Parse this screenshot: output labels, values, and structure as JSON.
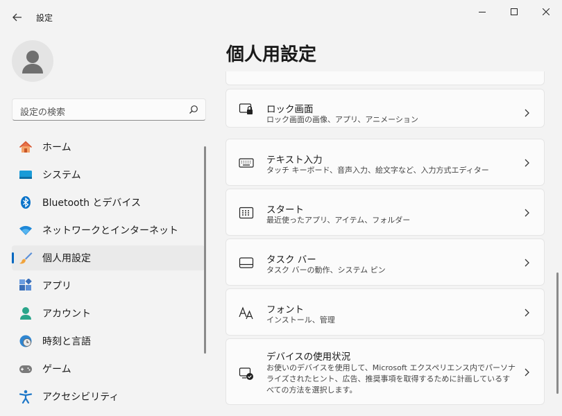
{
  "window": {
    "title": "設定"
  },
  "search": {
    "placeholder": "設定の検索"
  },
  "nav": {
    "items": [
      {
        "label": "ホーム",
        "icon": "home-icon"
      },
      {
        "label": "システム",
        "icon": "system-icon"
      },
      {
        "label": "Bluetooth とデバイス",
        "icon": "bluetooth-icon"
      },
      {
        "label": "ネットワークとインターネット",
        "icon": "wifi-icon"
      },
      {
        "label": "個人用設定",
        "icon": "paintbrush-icon",
        "selected": true
      },
      {
        "label": "アプリ",
        "icon": "apps-icon"
      },
      {
        "label": "アカウント",
        "icon": "account-icon"
      },
      {
        "label": "時刻と言語",
        "icon": "time-language-icon"
      },
      {
        "label": "ゲーム",
        "icon": "gamepad-icon"
      },
      {
        "label": "アクセシビリティ",
        "icon": "accessibility-icon"
      }
    ]
  },
  "main": {
    "title": "個人用設定",
    "cards": [
      {
        "title": "ロック画面",
        "desc": "ロック画面の画像、アプリ、アニメーション",
        "icon": "lock-screen-icon"
      },
      {
        "title": "テキスト入力",
        "desc": "タッチ キーボード、音声入力、絵文字など、入力方式エディター",
        "icon": "keyboard-icon"
      },
      {
        "title": "スタート",
        "desc": "最近使ったアプリ、アイテム、フォルダー",
        "icon": "start-icon"
      },
      {
        "title": "タスク バー",
        "desc": "タスク バーの動作、システム ピン",
        "icon": "taskbar-icon"
      },
      {
        "title": "フォント",
        "desc": "インストール、管理",
        "icon": "fonts-icon"
      },
      {
        "title": "デバイスの使用状況",
        "desc": "お使いのデバイスを使用して、Microsoft エクスペリエンス内でパーソナライズされたヒント、広告、推奨事項を取得するために計画しているすべての方法を選択します。",
        "icon": "device-usage-icon"
      }
    ]
  },
  "colors": {
    "accent": "#0067c0",
    "background": "#f3f3f3",
    "card": "#fbfbfb"
  }
}
